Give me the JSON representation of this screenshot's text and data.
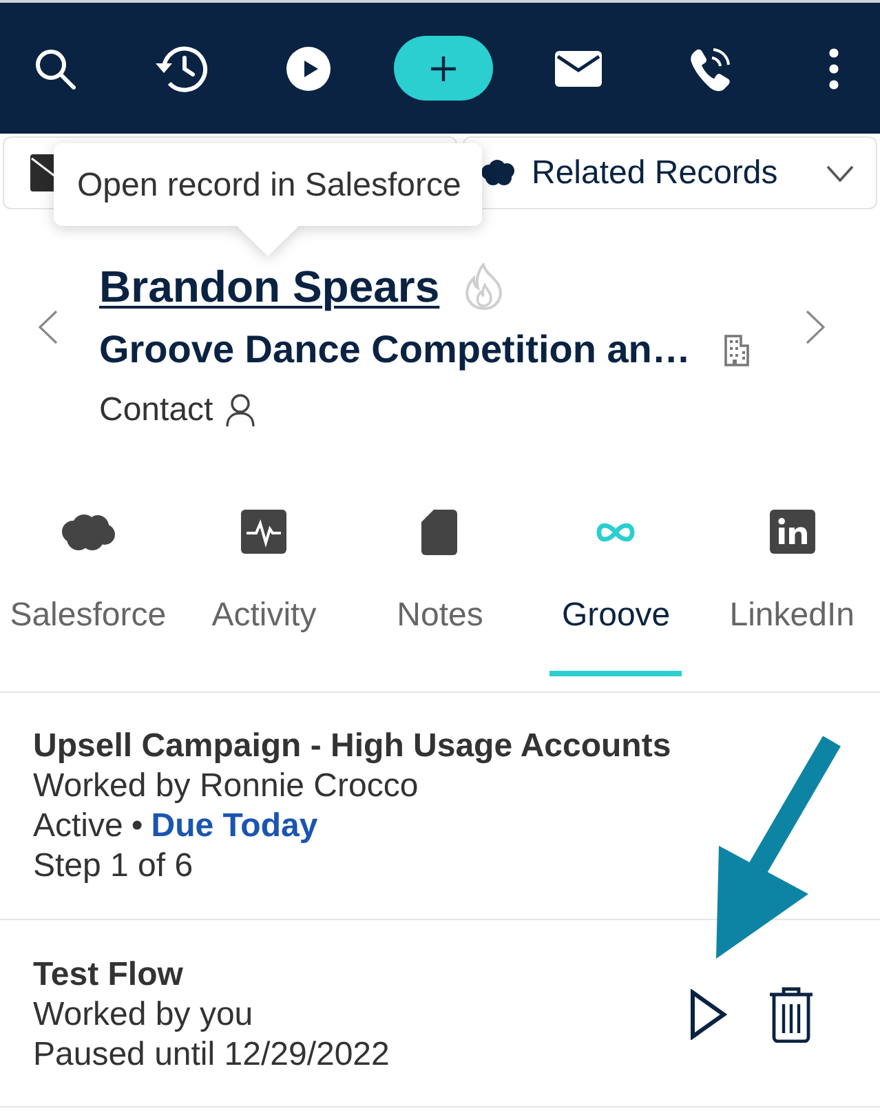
{
  "record_bar": {
    "related_records": {
      "label": "Related Records"
    }
  },
  "tooltip": {
    "text": "Open record in Salesforce"
  },
  "record": {
    "name": "Brandon Spears",
    "company": "Groove Dance Competition an…",
    "type": "Contact"
  },
  "tabs": [
    {
      "label": "Salesforce",
      "selected": false
    },
    {
      "label": "Activity",
      "selected": false
    },
    {
      "label": "Notes",
      "selected": false
    },
    {
      "label": "Groove",
      "selected": true
    },
    {
      "label": "LinkedIn",
      "selected": false
    }
  ],
  "flows": [
    {
      "kind": "active",
      "title": "Upsell Campaign - High Usage Accounts",
      "worked_by": "Worked by Ronnie Crocco",
      "status": "Active",
      "separator": "•",
      "due": "Due Today",
      "step": "Step 1 of 6"
    },
    {
      "kind": "paused",
      "title": "Test Flow",
      "worked_by": "Worked by you",
      "status": "Paused until 12/29/2022"
    }
  ]
}
